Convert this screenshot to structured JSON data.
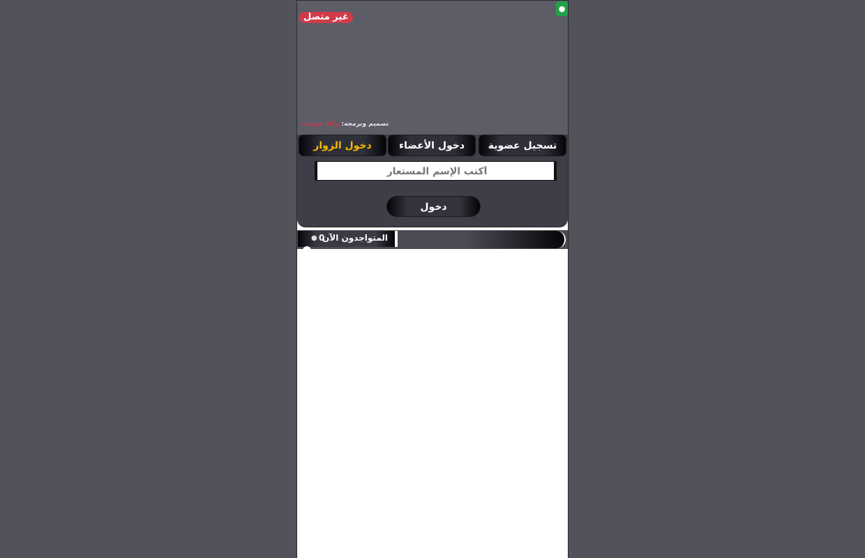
{
  "header": {
    "status_label": "غير متصل",
    "corner_button_icon": "user-icon",
    "credit_prefix": "تصميم وبرمجه:",
    "credit_name": "وكام هوست"
  },
  "tabs": [
    {
      "label": "تسجيل عضوية",
      "active": false
    },
    {
      "label": "دخول الأعضاء",
      "active": false
    },
    {
      "label": "دخول الزوار",
      "active": true
    }
  ],
  "login": {
    "name_placeholder": "أكتب الإسم المستعار",
    "name_value": "",
    "submit_label": "دخول"
  },
  "online": {
    "label": "المتواجدون الآن",
    "count": "0",
    "icon": "user-icon"
  },
  "colors": {
    "background": "#52525b",
    "status_badge": "#d23a4a",
    "corner_button": "#22a14a",
    "active_tab_text": "#f5b800"
  }
}
